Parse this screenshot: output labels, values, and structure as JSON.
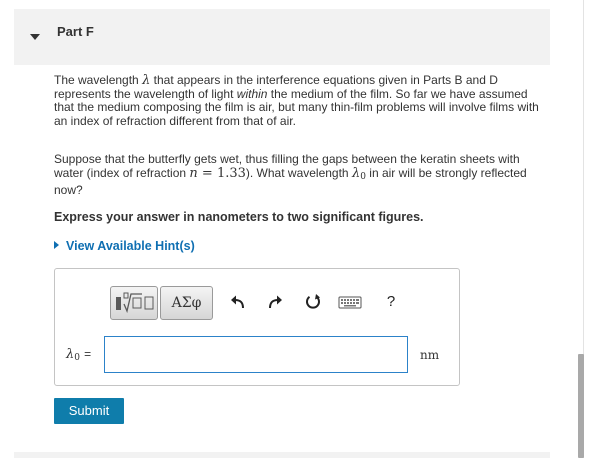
{
  "part": {
    "title": "Part F"
  },
  "question": {
    "para1_a": "The wavelength ",
    "para1_lambda": "λ",
    "para1_b": " that appears in the interference equations given in Parts B and D represents the wavelength of light ",
    "para1_within": "within",
    "para1_c": " the medium of the film. So far we have assumed that the medium composing the film is air, but many thin-film problems will involve films with an index of refraction different from that of air.",
    "para2_a": "Suppose that the butterfly gets wet, thus filling the gaps between the keratin sheets with water (index of refraction ",
    "para2_n": "n",
    "para2_eq": " = 1.33",
    "para2_b": "). What wavelength ",
    "para2_lambda": "λ",
    "para2_lambda_sub": "0",
    "para2_c": " in air will be strongly reflected now?",
    "instruction": "Express your answer in nanometers to two significant figures."
  },
  "hints": {
    "link_label": "View Available Hint(s)"
  },
  "toolbar": {
    "greek_label": "ΑΣφ",
    "help_label": "?",
    "icons": [
      "template-icon",
      "greek-letters",
      "undo-icon",
      "redo-icon",
      "reset-icon",
      "keyboard-icon",
      "help-icon"
    ]
  },
  "answer": {
    "variable": "λ",
    "variable_sub": "0",
    "equals": "=",
    "value": "",
    "unit": "nm"
  },
  "submit_label": "Submit",
  "colors": {
    "link": "#0f6fb2",
    "submit_bg": "#0f7dab",
    "input_border": "#2c82c9",
    "header_bg": "#f2f2f2"
  }
}
